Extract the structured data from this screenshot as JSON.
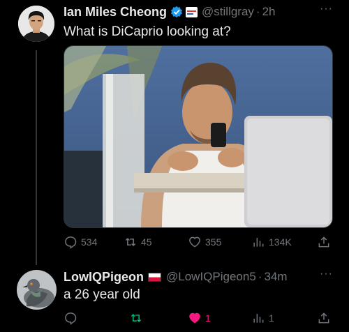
{
  "tweet": {
    "author_name": "Ian Miles Cheong",
    "handle": "@stillgray",
    "separator": "·",
    "time": "2h",
    "text": "What is DiCaprio looking at?",
    "more_icon": "more-horizontal-icon",
    "badges": [
      "verified-badge-icon",
      "affiliate-badge-icon"
    ],
    "stats": {
      "replies": "534",
      "reposts": "45",
      "likes": "355",
      "views": "134K"
    }
  },
  "reply": {
    "author_name": "LowIQPigeon",
    "flag": "flag-poland-icon",
    "handle": "@LowIQPigeon5",
    "separator": "·",
    "time": "34m",
    "text": "a 26 year old",
    "stats": {
      "replies": "",
      "reposts": "",
      "likes": "1",
      "views": "1"
    },
    "liked": true
  },
  "colors": {
    "background": "#000000",
    "text": "#e7e9ea",
    "muted": "#71767b",
    "verified": "#1d9bf0",
    "repost_active": "#00ba7c",
    "like_active": "#f91880"
  }
}
